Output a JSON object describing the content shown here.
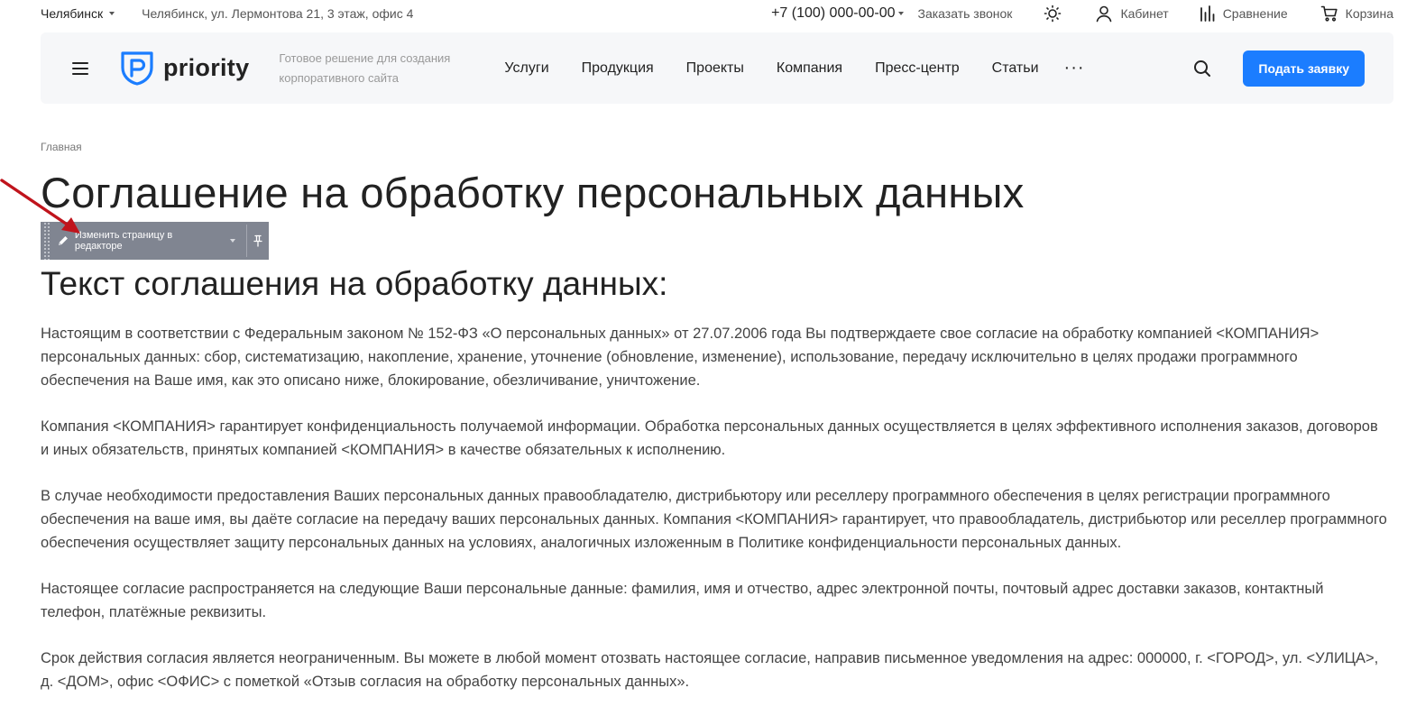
{
  "topbar": {
    "city": "Челябинск",
    "address": "Челябинск, ул. Лермонтова 21, 3 этаж, офис 4",
    "phone": "+7 (100) 000-00-00",
    "callback": "Заказать звонок",
    "cabinet": "Кабинет",
    "compare": "Сравнение",
    "cart": "Корзина"
  },
  "header": {
    "logo_text": "priority",
    "tagline": "Готовое решение для создания корпоративного сайта",
    "nav": [
      "Услуги",
      "Продукция",
      "Проекты",
      "Компания",
      "Пресс-центр",
      "Статьи"
    ],
    "more": "···",
    "cta": "Подать заявку"
  },
  "colors": {
    "accent": "#1b7dff",
    "header_bg": "#f6f7f9",
    "editor_bg": "#808591",
    "arrow": "#c0141c"
  },
  "breadcrumb": "Главная",
  "page_title": "Соглашение на обработку персональных данных",
  "editor": {
    "label": "Изменить страницу в редакторе",
    "edit_icon": "pencil-icon",
    "pin_icon": "pin-icon"
  },
  "subtitle": "Текст соглашения на обработку данных:",
  "paragraphs": [
    "Настоящим в соответствии с Федеральным законом № 152-ФЗ «О персональных данных» от 27.07.2006 года Вы подтверждаете свое согласие на обработку компанией <КОМПАНИЯ> персональных данных: сбор, систематизацию, накопление, хранение, уточнение (обновление, изменение), использование, передачу исключительно в целях продажи программного обеспечения на Ваше имя, как это описано ниже, блокирование, обезличивание, уничтожение.",
    "Компания <КОМПАНИЯ> гарантирует конфиденциальность получаемой информации. Обработка персональных данных осуществляется в целях эффективного исполнения заказов, договоров и иных обязательств, принятых компанией <КОМПАНИЯ> в качестве обязательных к исполнению.",
    "В случае необходимости предоставления Ваших персональных данных правообладателю, дистрибьютору или реселлеру программного обеспечения в целях регистрации программного обеспечения на ваше имя, вы даёте согласие на передачу ваших персональных данных. Компания <КОМПАНИЯ> гарантирует, что правообладатель, дистрибьютор или реселлер программного обеспечения осуществляет защиту персональных данных на условиях, аналогичных изложенным в Политике конфиденциальности персональных данных.",
    "Настоящее согласие распространяется на следующие Ваши персональные данные: фамилия, имя и отчество, адрес электронной почты, почтовый адрес доставки заказов, контактный телефон, платёжные реквизиты.",
    "Срок действия согласия является неограниченным. Вы можете в любой момент отозвать настоящее согласие, направив письменное уведомления на адрес: 000000, г. <ГОРОД>, ул. <УЛИЦА>, д. <ДОМ>, офис <ОФИС> с пометкой «Отзыв согласия на обработку персональных данных»."
  ]
}
